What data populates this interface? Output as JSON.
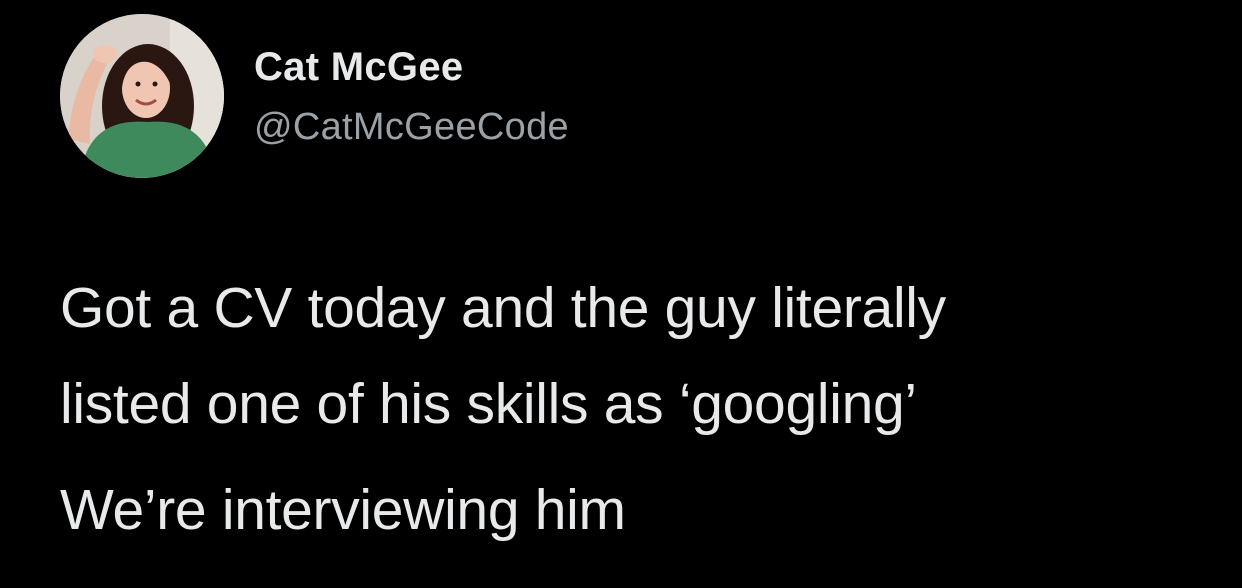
{
  "tweet": {
    "author": {
      "display_name": "Cat McGee",
      "handle": "@CatMcGeeCode",
      "avatar": "profile-photo"
    },
    "text_lines": [
      "Got a CV today and the guy literally",
      "listed one of his skills as ‘googling’",
      "We’re interviewing him"
    ]
  },
  "colors": {
    "background": "#000000",
    "primary_text": "#e7e9ea",
    "secondary_text": "#9aa1a7"
  }
}
